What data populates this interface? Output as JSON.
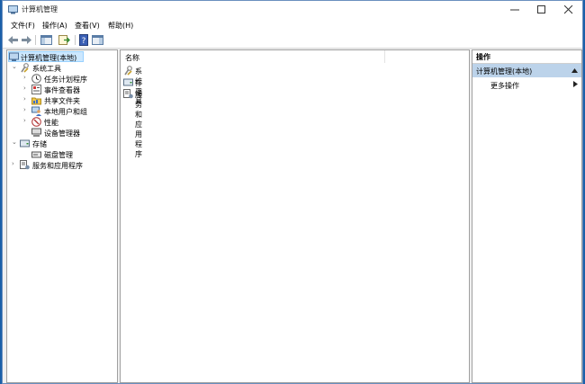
{
  "window": {
    "title": "计算机管理",
    "controls": [
      "minimize",
      "maximize",
      "close"
    ]
  },
  "menu": [
    "文件(F)",
    "操作(A)",
    "查看(V)",
    "帮助(H)"
  ],
  "toolbar": {
    "buttons": [
      "back-arrow-icon",
      "forward-arrow-icon",
      "show-hide-tree-icon",
      "export-list-icon",
      "help-icon",
      "show-hide-action-pane-icon"
    ]
  },
  "tree": {
    "root": "计算机管理(本地)",
    "system_tools": "系统工具",
    "task_scheduler": "任务计划程序",
    "event_viewer": "事件查看器",
    "shared_folders": "共享文件夹",
    "local_users": "本地用户和组",
    "performance": "性能",
    "device_manager": "设备管理器",
    "storage": "存储",
    "disk_management": "磁盘管理",
    "services_apps": "服务和应用程序"
  },
  "main": {
    "column_name": "名称",
    "items": [
      "系统工具",
      "存储",
      "服务和应用程序"
    ]
  },
  "actions": {
    "header": "操作",
    "section": "计算机管理(本地)",
    "more": "更多操作"
  },
  "colors": {
    "desktop": "#1b5fa8",
    "selection": "#cce8ff",
    "action_section": "#bcd3ea"
  }
}
